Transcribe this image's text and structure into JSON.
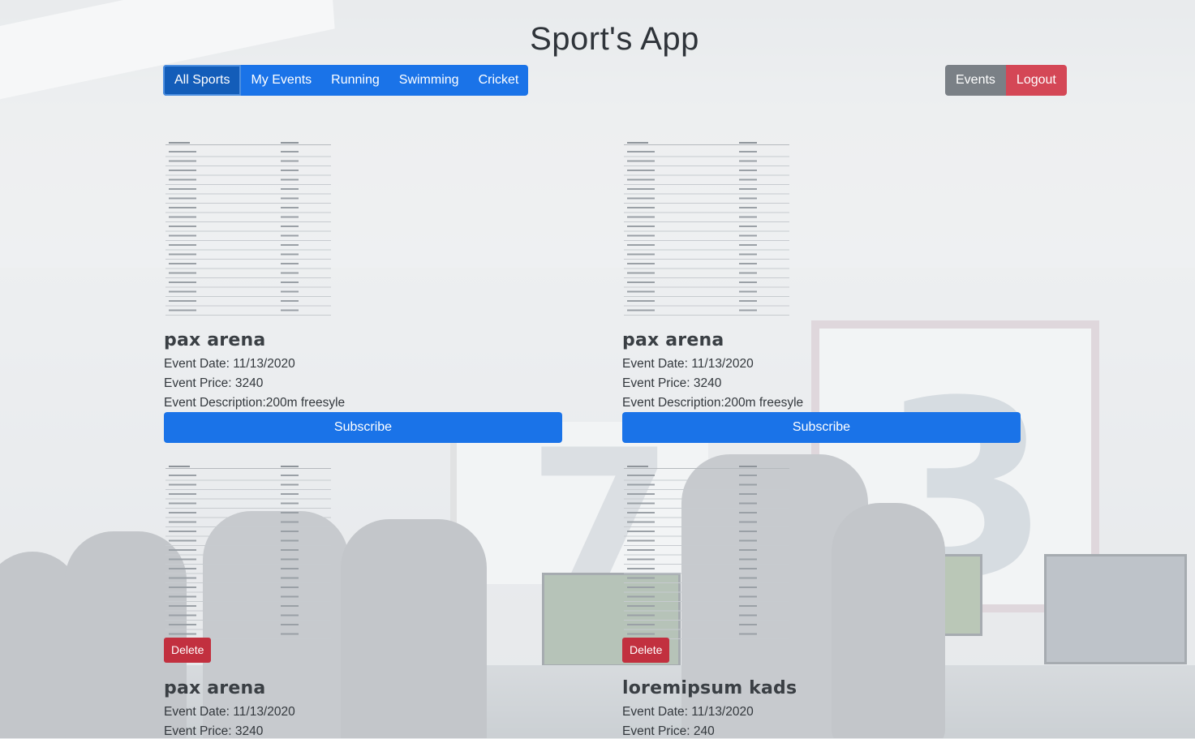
{
  "app": {
    "title": "Sport's App"
  },
  "nav": {
    "sports": [
      {
        "label": "All Sports",
        "active": true
      },
      {
        "label": "My Events",
        "active": false
      },
      {
        "label": "Running",
        "active": false
      },
      {
        "label": "Swimming",
        "active": false
      },
      {
        "label": "Cricket",
        "active": false
      }
    ],
    "events_label": "Events",
    "logout_label": "Logout"
  },
  "events": [
    {
      "title": "pax arena",
      "date": "Event Date: 11/13/2020",
      "price": "Event Price: 3240",
      "description": "Event Description:200m freesyle",
      "action": "Subscribe"
    },
    {
      "title": "pax arena",
      "date": "Event Date: 11/13/2020",
      "price": "Event Price: 3240",
      "description": "Event Description:200m freesyle",
      "action": "Subscribe"
    },
    {
      "title": "pax arena",
      "date": "Event Date: 11/13/2020",
      "price": "Event Price: 3240",
      "action": "Delete"
    },
    {
      "title": "loremipsum kads",
      "date": "Event Date: 11/13/2020",
      "price": "Event Price: 240",
      "action": "Delete"
    }
  ],
  "colors": {
    "primary": "#1a73e8",
    "primary_active": "#135db9",
    "secondary": "#7a8086",
    "danger": "#d44756",
    "delete": "#c2303f"
  },
  "icons": {
    "thumbnail": "table-thumbnail-image"
  }
}
